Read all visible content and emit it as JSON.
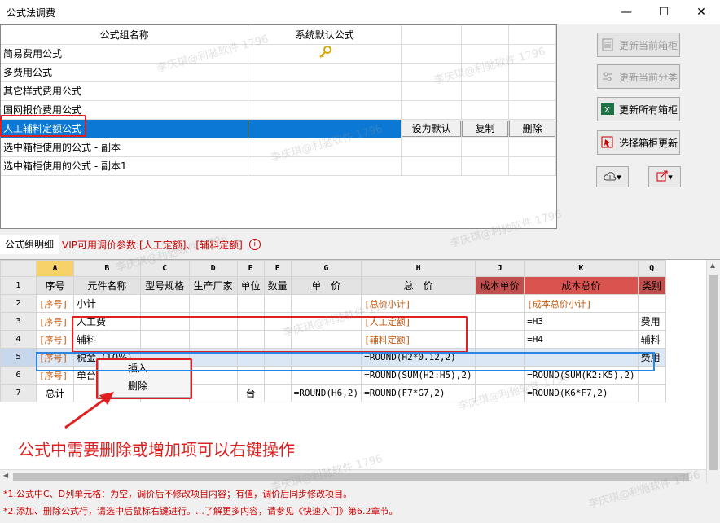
{
  "window": {
    "title": "公式法调费",
    "min": "—",
    "max": "☐",
    "close": "✕"
  },
  "formula_groups": {
    "headers": [
      "公式组名称",
      "系统默认公式"
    ],
    "rows": [
      {
        "name": "简易费用公式",
        "default": true
      },
      {
        "name": "多费用公式",
        "default": false
      },
      {
        "name": "其它样式费用公式",
        "default": false
      },
      {
        "name": "国网报价费用公式",
        "default": false
      },
      {
        "name": "人工辅料定额公式",
        "default": false
      },
      {
        "name": "选中箱柜使用的公式 - 副本",
        "default": false
      },
      {
        "name": "选中箱柜使用的公式 - 副本1",
        "default": false
      }
    ],
    "row_actions": [
      "设为默认",
      "复制",
      "删除"
    ],
    "default_icon": "key-icon"
  },
  "side_buttons": [
    {
      "label": "更新当前箱柜",
      "enabled": false,
      "icon": "document-icon"
    },
    {
      "label": "更新当前分类",
      "enabled": false,
      "icon": "sliders-icon"
    },
    {
      "label": "更新所有箱柜",
      "enabled": true,
      "icon": "excel-icon"
    },
    {
      "label": "选择箱柜更新",
      "enabled": true,
      "icon": "cursor-select-icon"
    }
  ],
  "detail": {
    "tab": "公式组明细",
    "vip": "VIP可用调价参数:[人工定额]、[辅料定额]",
    "vip_icon": "info-icon"
  },
  "sheet": {
    "cols": [
      "A",
      "B",
      "C",
      "D",
      "E",
      "F",
      "G",
      "H",
      "J",
      "K",
      "Q"
    ],
    "rows": [
      {
        "n": "1",
        "cells": [
          "序号",
          "元件名称",
          "型号规格",
          "生产厂家",
          "单位",
          "数量",
          "单　价",
          "总　价",
          "成本单价",
          "成本总价",
          "类别"
        ]
      },
      {
        "n": "2",
        "cells": [
          "[序号]",
          "小计",
          "",
          "",
          "",
          "",
          "",
          "[总价小计]",
          "",
          "[成本总价小计]",
          ""
        ]
      },
      {
        "n": "3",
        "cells": [
          "[序号]",
          "人工费",
          "",
          "",
          "",
          "",
          "",
          "[人工定额]",
          "",
          "=H3",
          "费用"
        ]
      },
      {
        "n": "4",
        "cells": [
          "[序号]",
          "辅料",
          "",
          "",
          "",
          "",
          "",
          "[辅料定额]",
          "",
          "=H4",
          "辅料"
        ]
      },
      {
        "n": "5",
        "cells": [
          "[序号]",
          "税金（10%）",
          "",
          "",
          "",
          "",
          "",
          "=ROUND(H2*0.12,2)",
          "",
          "",
          "费用"
        ]
      },
      {
        "n": "6",
        "cells": [
          "[序号]",
          "单台",
          "",
          "",
          "",
          "",
          "",
          "=ROUND(SUM(H2:H5),2)",
          "",
          "=ROUND(SUM(K2:K5),2)",
          ""
        ]
      },
      {
        "n": "7",
        "cells": [
          "总计",
          "",
          "",
          "",
          "台",
          "",
          "=ROUND(H6,2)",
          "=ROUND(F7*G7,2)",
          "",
          "=ROUND(K6*F7,2)",
          ""
        ]
      }
    ]
  },
  "context_menu": [
    "插入",
    "删除"
  ],
  "annotation": "公式中需要删除或增加项可以右键操作",
  "footnotes": [
    "*1.公式中C、D列单元格：为空，调价后不修改项目内容；有值，调价后同步修改项目。",
    "*2.添加、删除公式行，请选中后鼠标右键进行。…了解更多内容，请参见《快速入门》第6.2章节。"
  ],
  "watermark": "李庆琪@利驰软件 1796"
}
